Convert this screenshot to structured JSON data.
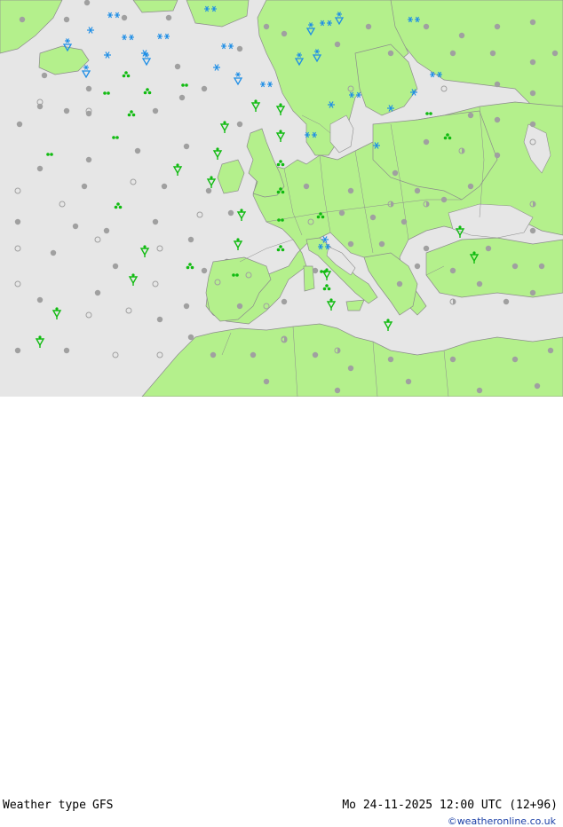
{
  "footer": {
    "label_type": "Weather type",
    "model": "GFS",
    "valid_time": "Mo 24-11-2025 12:00 UTC (12+96)",
    "credit": "©weatheronline.co.uk"
  },
  "colors": {
    "sea": "#e6e6e6",
    "land": "#b4f08c",
    "border": "#8c8c8c",
    "rain": "#11bb11",
    "snow": "#1e8ee6",
    "neutral": "#a0a0a0"
  },
  "legend_symbols": [
    "dot",
    "circle",
    "half",
    "rain-shower",
    "rain-dots",
    "rain-three",
    "snow-star",
    "snow-shower"
  ]
}
